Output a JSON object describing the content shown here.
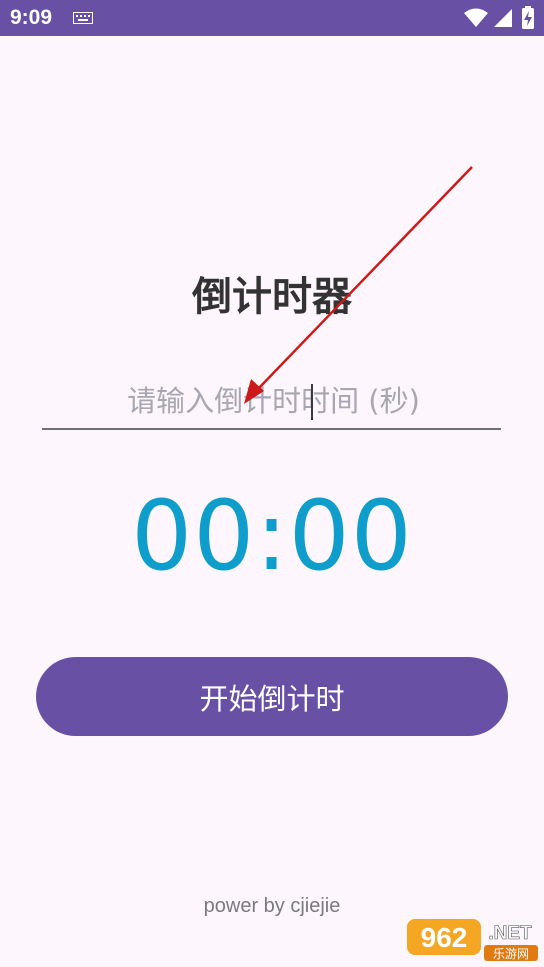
{
  "status_bar": {
    "time": "9:09",
    "icons": [
      "keyboard-icon",
      "wifi-icon",
      "signal-icon",
      "battery-charging-icon"
    ]
  },
  "app": {
    "title": "倒计时器",
    "input": {
      "value": "",
      "placeholder": "请输入倒计时时间 (秒)"
    },
    "countdown_display": "00:00",
    "start_button_label": "开始倒计时",
    "footer": "power by cjiejie"
  },
  "watermark": {
    "text_main": "962",
    "text_suffix": ".NET",
    "text_sub": "乐游网"
  },
  "colors": {
    "status_bar": "#6851a5",
    "background": "#fdf7fd",
    "accent_button": "#6851a5",
    "countdown_text": "#0f9dcb",
    "annotation_arrow": "#cc1a1a"
  }
}
